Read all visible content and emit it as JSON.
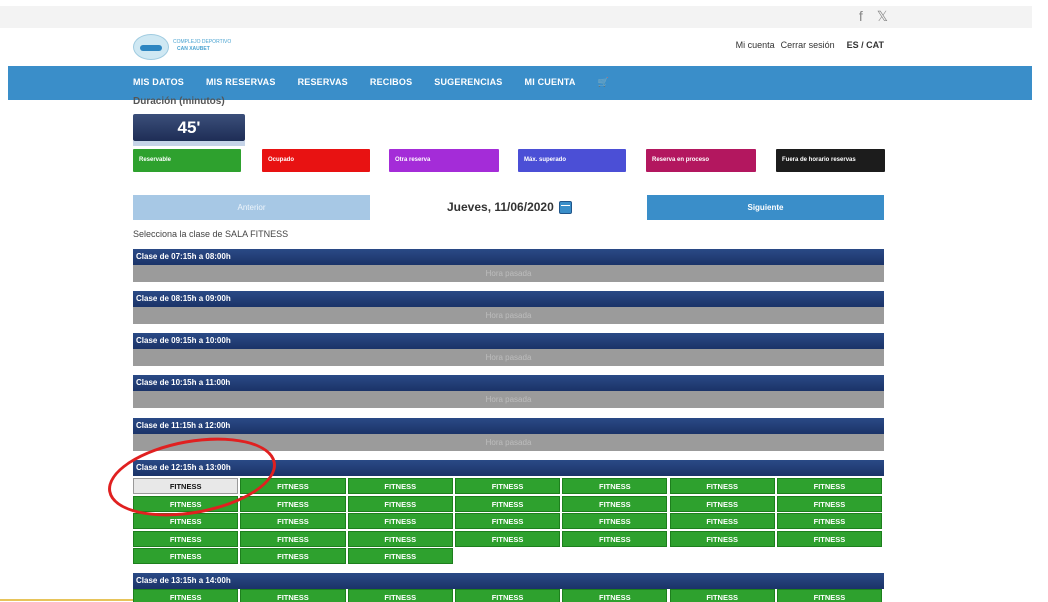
{
  "social": {
    "facebook": "f",
    "twitter": "𝕏"
  },
  "account": {
    "my_account": "Mi cuenta",
    "logout": "Cerrar sesión",
    "lang": "ES / CAT"
  },
  "logo": {
    "line1": "COMPLEJO DEPORTIVO",
    "line2": "CAN XAUBET"
  },
  "nav": [
    "MIS DATOS",
    "MIS RESERVAS",
    "RESERVAS",
    "RECIBOS",
    "SUGERENCIAS",
    "MI CUENTA"
  ],
  "duration": {
    "label": "Duración (minutos)",
    "value": "45'"
  },
  "legend": [
    {
      "label": "Reservable",
      "color": "#2ea12e"
    },
    {
      "label": "Ocupado",
      "color": "#e81212"
    },
    {
      "label": "Otra reserva",
      "color": "#a42cd8"
    },
    {
      "label": "Máx. superado",
      "color": "#4b4fd6"
    },
    {
      "label": "Reserva en proceso",
      "color": "#b3175f"
    },
    {
      "label": "Fuera de horario reservas",
      "color": "#1c1c1c"
    }
  ],
  "pager": {
    "prev": "Anterior",
    "date": "Jueves, 11/06/2020",
    "next": "Siguiente"
  },
  "prompt": "Selecciona la clase de SALA FITNESS",
  "past_label": "Hora pasada",
  "slots": [
    {
      "title": "Clase de 07:15h a 08:00h"
    },
    {
      "title": "Clase de 08:15h a 09:00h"
    },
    {
      "title": "Clase de 09:15h a 10:00h"
    },
    {
      "title": "Clase de 10:15h a 11:00h"
    },
    {
      "title": "Clase de 11:15h a 12:00h"
    },
    {
      "title": "Clase de 12:15h a 13:00h"
    },
    {
      "title": "Clase de 13:15h a 14:00h"
    }
  ],
  "class_label": "FITNESS",
  "available_count": 31
}
